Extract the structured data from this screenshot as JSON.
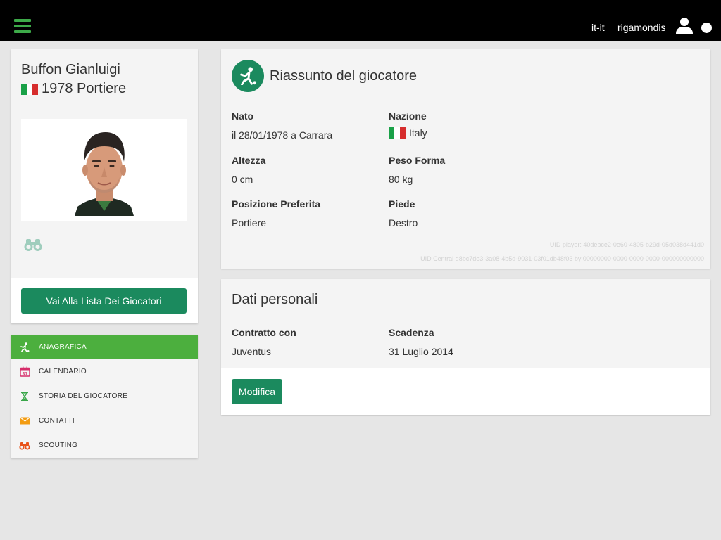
{
  "header": {
    "locale": "it-it",
    "username": "rigamondis",
    "icons": {
      "menu": "hamburger-icon",
      "user": "user-icon",
      "status": "status-dot"
    }
  },
  "profile": {
    "name": "Buffon Gianluigi",
    "subtitle": "1978 Portiere",
    "flag": "italy-flag",
    "list_button": "Vai Alla Lista Dei Giocatori"
  },
  "menu": {
    "items": [
      {
        "label": "ANAGRAFICA",
        "icon": "player-kick-icon",
        "active": true
      },
      {
        "label": "CALENDARIO",
        "icon": "calendar-icon",
        "active": false,
        "icon_text": "31"
      },
      {
        "label": "STORIA DEL GIOCATORE",
        "icon": "hourglass-icon",
        "active": false
      },
      {
        "label": "CONTATTI",
        "icon": "envelope-icon",
        "active": false
      },
      {
        "label": "SCOUTING",
        "icon": "binoculars-icon",
        "active": false
      }
    ]
  },
  "summary": {
    "title": "Riassunto del giocatore",
    "fields": {
      "born_label": "Nato",
      "born_value": "il 28/01/1978 a Carrara",
      "nation_label": "Nazione",
      "nation_value": "Italy",
      "height_label": "Altezza",
      "height_value": "0 cm",
      "weight_label": "Peso Forma",
      "weight_value": "80 kg",
      "position_label": "Posizione Preferita",
      "position_value": "Portiere",
      "foot_label": "Piede",
      "foot_value": "Destro"
    },
    "uid_player": "UID player: 40debce2-0e60-4805-b29d-05d038d441d0",
    "uid_central": "UID Central d8bc7de3-3a08-4b5d-9031-03f01db48f03 by 00000000-0000-0000-0000-000000000000"
  },
  "personal": {
    "title": "Dati personali",
    "contract_label": "Contratto con",
    "contract_value": "Juventus",
    "expiry_label": "Scadenza",
    "expiry_value": "31 Luglio 2014",
    "edit_button": "Modifica"
  },
  "colors": {
    "primary": "#1b8a5e",
    "active_menu": "#4caf3e",
    "topbar": "#000000",
    "accent_menu": "#3daa49",
    "calendar": "#d62d6a",
    "hourglass": "#3aa64a",
    "envelope": "#f39c12",
    "scouting": "#e8541c"
  }
}
